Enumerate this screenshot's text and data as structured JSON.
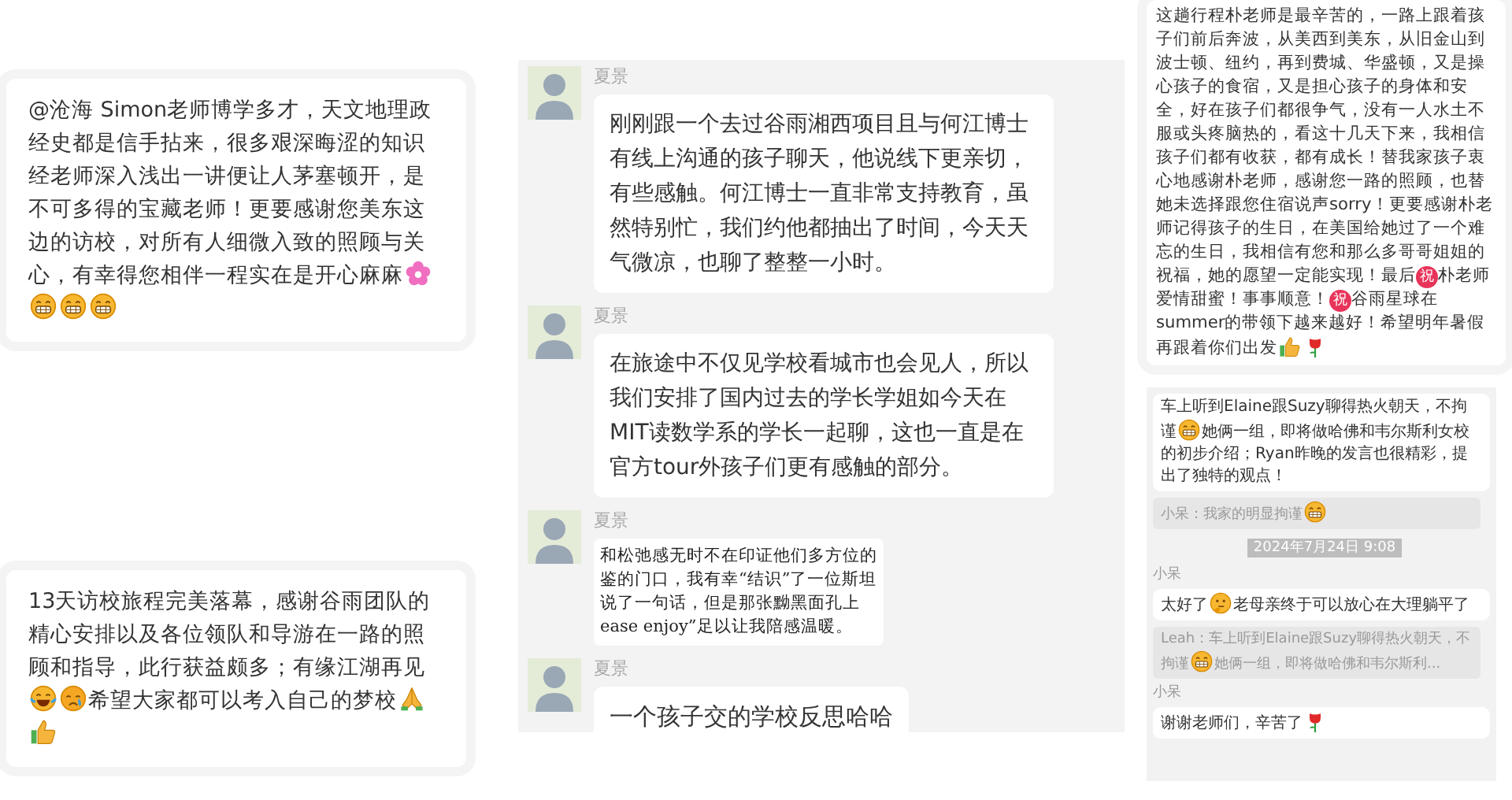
{
  "left_cards": [
    {
      "segments": [
        {
          "kind": "text",
          "text": "@沧海 Simon老师博学多才，天文地理政经史都是信手拈来，很多艰深晦涩的知识经老师深入浅出一讲便让人茅塞顿开，是不可多得的宝藏老师！更要感谢您美东这边的访校，对所有人细微入致的照顾与关心，有幸得您相伴一程实在是开心麻麻"
        },
        {
          "kind": "flower"
        },
        {
          "kind": "grin"
        },
        {
          "kind": "grin"
        },
        {
          "kind": "grin"
        }
      ]
    },
    {
      "segments": [
        {
          "kind": "text",
          "text": "13天访校旅程完美落幕，感谢谷雨团队的精心安排以及各位领队和导游在一路的照顾和指导，此行获益颇多；有缘江湖再见"
        },
        {
          "kind": "laugh"
        },
        {
          "kind": "cry"
        },
        {
          "kind": "text",
          "text": "希望大家都可以考入自己的梦校"
        },
        {
          "kind": "pray"
        },
        {
          "kind": "thumbs"
        }
      ]
    }
  ],
  "group_chat": {
    "messages": [
      {
        "sender": "夏景",
        "kind": "text",
        "text": "刚刚跟一个去过谷雨湘西项目且与何江博士有线上沟通的孩子聊天，他说线下更亲切，有些感触。何江博士一直非常支持教育，虽然特别忙，我们约他都抽出了时间，今天天气微凉，也聊了整整一小时。"
      },
      {
        "sender": "夏景",
        "kind": "text",
        "text": "在旅途中不仅见学校看城市也会见人，所以我们安排了国内过去的学长学姐如今天在MIT读数学系的学长一起聊，这也一直是在官方tour外孩子们更有感触的部分。"
      },
      {
        "sender": "夏景",
        "kind": "document",
        "lines": [
          "和松弛感无时不在印证他们多方位的",
          "鉴的门口，我有幸“结识”了一位斯坦",
          "说了一句话，但是那张黝黑面孔上",
          "ease enjoy”足以让我陪感温暖。"
        ]
      },
      {
        "sender": "夏景",
        "kind": "text",
        "text": "一个孩子交的学校反思哈哈"
      }
    ]
  },
  "right_card": {
    "segments": [
      {
        "kind": "text",
        "text": "这趟行程朴老师是最辛苦的，一路上跟着孩子们前后奔波，从美西到美东，从旧金山到波士顿、纽约，再到费城、华盛顿，又是操心孩子的食宿，又是担心孩子的身体和安全，好在孩子们都很争气，没有一人水土不服或头疼脑热的，看这十几天下来，我相信孩子们都有收获，都有成长！替我家孩子衷心地感谢朴老师，感谢您一路的照顾，也替她未选择跟您住宿说声sorry！更要感谢朴老师记得孩子的生日，在美国给她过了一个难忘的生日，我相信有您和那么多哥哥姐姐的祝福，她的愿望一定能实现！最后"
      },
      {
        "kind": "badge",
        "text": "祝"
      },
      {
        "kind": "text",
        "text": "朴老师爱情甜蜜！事事顺意！"
      },
      {
        "kind": "badge",
        "text": "祝"
      },
      {
        "kind": "text",
        "text": "谷雨星球在summer的带领下越来越好！希望明年暑假再跟着你们出发"
      },
      {
        "kind": "thumbs"
      },
      {
        "kind": "rose"
      }
    ]
  },
  "right_chat": {
    "items": [
      {
        "kind": "bubble",
        "segments": [
          {
            "kind": "text",
            "text": "车上听到Elaine跟Suzy聊得热火朝天，不拘谨"
          },
          {
            "kind": "grin"
          },
          {
            "kind": "text",
            "text": "她俩一组，即将做哈佛和韦尔斯利女校的初步介绍；Ryan昨晚的发言也很精彩，提出了独特的观点！"
          }
        ]
      },
      {
        "kind": "quote",
        "segments": [
          {
            "kind": "text",
            "text": "小呆：我家的明显拘谨"
          },
          {
            "kind": "grin"
          }
        ]
      },
      {
        "kind": "time",
        "text": "2024年7月24日 9:08"
      },
      {
        "kind": "sender",
        "text": "小呆"
      },
      {
        "kind": "bubble",
        "segments": [
          {
            "kind": "text",
            "text": "太好了"
          },
          {
            "kind": "think"
          },
          {
            "kind": "text",
            "text": "老母亲终于可以放心在大理躺平了"
          }
        ]
      },
      {
        "kind": "quote",
        "segments": [
          {
            "kind": "text",
            "text": "Leah：车上听到Elaine跟Suzy聊得热火朝天，不拘谨"
          },
          {
            "kind": "grin"
          },
          {
            "kind": "text",
            "text": "她俩一组，即将做哈佛和韦尔斯利..."
          }
        ]
      },
      {
        "kind": "sender",
        "text": "小呆"
      },
      {
        "kind": "bubble",
        "segments": [
          {
            "kind": "text",
            "text": "谢谢老师们，辛苦了"
          },
          {
            "kind": "rose"
          }
        ]
      }
    ]
  }
}
